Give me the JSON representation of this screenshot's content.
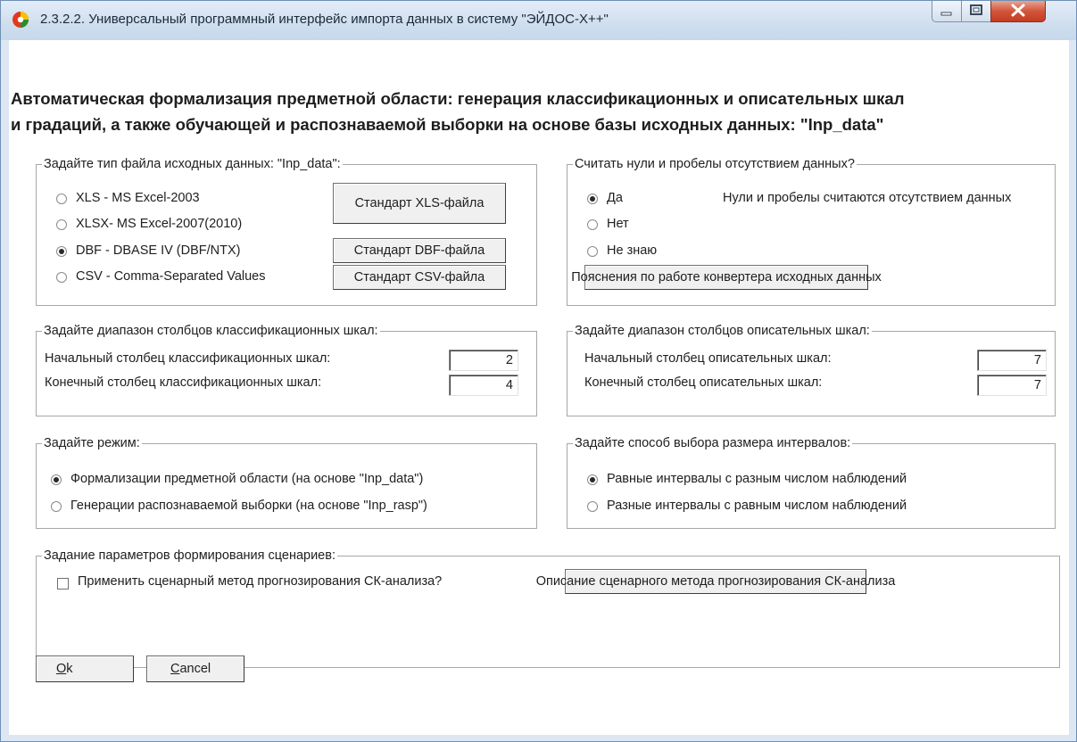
{
  "window": {
    "title": "2.3.2.2. Универсальный программный интерфейс импорта данных в систему \"ЭЙДОС-Х++\"",
    "controls": [
      "minimize-icon",
      "maximize-icon",
      "close-icon"
    ]
  },
  "heading": {
    "line1": "Автоматическая формализация предметной области: генерация классификационных и описательных шкал",
    "line2": "и градаций,  а также обучающей и распознаваемой выборки  на  основе  базы исходных данных: \"Inp_data\""
  },
  "file_type": {
    "legend": "Задайте тип файла исходных данных: \"Inp_data\":",
    "options": [
      {
        "label": "XLS  - MS Excel-2003",
        "selected": false
      },
      {
        "label": "XLSX- MS Excel-2007(2010)",
        "selected": false
      },
      {
        "label": "DBF  - DBASE IV (DBF/NTX)",
        "selected": true
      },
      {
        "label": "CSV  - Comma-Separated Values",
        "selected": false
      }
    ],
    "buttons": {
      "xls": "Стандарт XLS-файла",
      "dbf": "Стандарт DBF-файла",
      "csv": "Стандарт CSV-файла"
    }
  },
  "zeros": {
    "legend": "Считать нули и пробелы отсутствием данных?",
    "options": [
      {
        "label": "Да",
        "selected": true
      },
      {
        "label": "Нет",
        "selected": false
      },
      {
        "label": "Не знаю",
        "selected": false
      }
    ],
    "hint": "Нули и пробелы считаются отсутствием данных",
    "explain_button": "Пояснения по работе конвертера исходных данных"
  },
  "class_scales": {
    "legend": "Задайте диапазон столбцов классификационных шкал:",
    "start_label": "Начальный столбец классификационных шкал:",
    "start_value": "2",
    "end_label": "Конечный  столбец классификационных шкал:",
    "end_value": "4"
  },
  "desc_scales": {
    "legend": "Задайте диапазон столбцов описательных шкал:",
    "start_label": "Начальный столбец описательных шкал:",
    "start_value": "7",
    "end_label": "Конечный  столбец описательных шкал:",
    "end_value": "7"
  },
  "mode": {
    "legend": "Задайте режим:",
    "options": [
      {
        "label": "Формализации предметной  области (на основе \"Inp_data\")",
        "selected": true
      },
      {
        "label": "Генерации распознаваемой выборки (на основе \"Inp_rasp\")",
        "selected": false
      }
    ]
  },
  "intervals": {
    "legend": "Задайте способ выбора размера интервалов:",
    "options": [
      {
        "label": "Равные интервалы с разным числом наблюдений",
        "selected": true
      },
      {
        "label": "Разные интервалы с равным числом наблюдений",
        "selected": false
      }
    ]
  },
  "scenarios": {
    "legend": "Задание параметров формирования сценариев:",
    "checkbox_label": "Применить сценарный метод прогнозирования СК-анализа?",
    "checked": false,
    "describe_button": "Описание сценарного метода прогнозирования СК-анализа"
  },
  "footer": {
    "ok": "Ok",
    "cancel": "Cancel"
  }
}
